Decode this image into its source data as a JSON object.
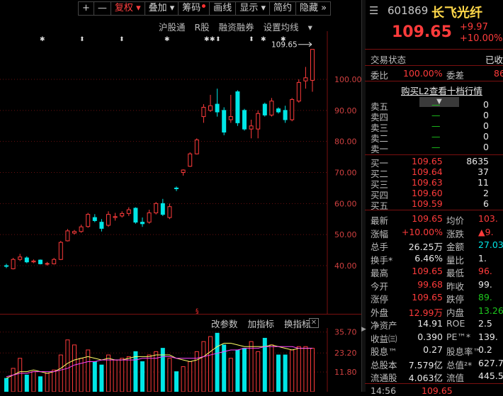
{
  "toolbar": {
    "plus": "+",
    "minus": "—",
    "fuquan": "复权",
    "diejia": "叠加",
    "chouma": "筹码",
    "huaxian": "画线",
    "xianshi": "显示",
    "jianyue": "简约",
    "yincang": "隐藏",
    "expand": "»"
  },
  "chart_links": [
    "沪股通",
    "R股",
    "融资融券",
    "设置均线"
  ],
  "price_axis": [
    "100.00",
    "90.00",
    "80.00",
    "70.00",
    "60.00",
    "50.00",
    "40.00"
  ],
  "high_label": "109.65",
  "volume_axis": [
    "35.70",
    "23.20",
    "11.80"
  ],
  "indicator_tools": [
    "改参数",
    "加指标",
    "换指标"
  ],
  "colors": {
    "up": "#ff3b3b",
    "down": "#00e6e6",
    "bg": "#000000",
    "grid": "#7a1010"
  },
  "stock": {
    "code": "601869",
    "name": "长飞光纤",
    "price": "109.65",
    "change": "+9.97",
    "change_pct": "+10.00%"
  },
  "status": {
    "label": "交易状态",
    "value": "已收"
  },
  "weibi": {
    "label": "委比",
    "value": "100.00%",
    "label2": "委差",
    "value2": "86"
  },
  "l2_button": "购买L2查看十档行情",
  "order_book": {
    "asks": [
      {
        "label": "卖五",
        "price": "—",
        "vol": "0"
      },
      {
        "label": "卖四",
        "price": "—",
        "vol": "0"
      },
      {
        "label": "卖三",
        "price": "—",
        "vol": "0"
      },
      {
        "label": "卖二",
        "price": "—",
        "vol": "0"
      },
      {
        "label": "卖一",
        "price": "—",
        "vol": "0"
      }
    ],
    "bids": [
      {
        "label": "买一",
        "price": "109.65",
        "vol": "8635"
      },
      {
        "label": "买二",
        "price": "109.64",
        "vol": "37"
      },
      {
        "label": "买三",
        "price": "109.63",
        "vol": "11"
      },
      {
        "label": "买四",
        "price": "109.60",
        "vol": "2"
      },
      {
        "label": "买五",
        "price": "109.59",
        "vol": "6"
      }
    ]
  },
  "quote": [
    {
      "l1": "最新",
      "v1": "109.65",
      "c1": "red",
      "l2": "均价",
      "v2": "103.",
      "c2": "red"
    },
    {
      "l1": "涨幅",
      "v1": "+10.00%",
      "c1": "red",
      "l2": "涨跌",
      "v2": "▲9.",
      "c2": "red"
    },
    {
      "l1": "总手",
      "v1": "26.25万",
      "c1": "white",
      "l2": "金额",
      "v2": "27.03",
      "c2": "cyan"
    },
    {
      "l1": "换手*",
      "v1": "6.46%",
      "c1": "white",
      "l2": "量比",
      "v2": "1.",
      "c2": "white"
    },
    {
      "l1": "最高",
      "v1": "109.65",
      "c1": "red",
      "l2": "最低",
      "v2": "96.",
      "c2": "red"
    },
    {
      "l1": "今开",
      "v1": "99.68",
      "c1": "red",
      "l2": "昨收",
      "v2": "99.",
      "c2": "white"
    },
    {
      "l1": "涨停",
      "v1": "109.65",
      "c1": "red",
      "l2": "跌停",
      "v2": "89.",
      "c2": "green"
    },
    {
      "l1": "外盘",
      "v1": "12.99万",
      "c1": "red",
      "l2": "内盘",
      "v2": "13.26",
      "c2": "green"
    },
    {
      "l1": "净资产",
      "v1": "14.91",
      "c1": "white",
      "l2": "ROE",
      "v2": "2.5",
      "c2": "white"
    },
    {
      "l1": "收益㈢",
      "v1": "0.390",
      "c1": "white",
      "l2": "PE™*",
      "v2": "139.",
      "c2": "white"
    },
    {
      "l1": "股息™",
      "v1": "0.27",
      "c1": "white",
      "l2": "股息率™",
      "v2": "0.2",
      "c2": "white"
    },
    {
      "l1": "总股本",
      "v1": "7.579亿",
      "c1": "white",
      "l2": "总值²*",
      "v2": "627.7",
      "c2": "white"
    },
    {
      "l1": "流通股",
      "v1": "4.063亿",
      "c1": "white",
      "l2": "流值",
      "v2": "445.5",
      "c2": "white"
    }
  ],
  "last_trade": {
    "time": "14:56",
    "price": "109.65"
  },
  "chart_data": {
    "type": "candlestick",
    "ylim": [
      36,
      112
    ],
    "candles": [
      {
        "o": 40.0,
        "h": 40.6,
        "l": 39.2,
        "c": 39.8
      },
      {
        "o": 39.0,
        "h": 42.5,
        "l": 38.8,
        "c": 42.0
      },
      {
        "o": 42.0,
        "h": 43.8,
        "l": 41.5,
        "c": 42.8
      },
      {
        "o": 42.5,
        "h": 43.0,
        "l": 40.8,
        "c": 41.2
      },
      {
        "o": 41.2,
        "h": 42.0,
        "l": 40.8,
        "c": 41.5
      },
      {
        "o": 41.8,
        "h": 42.0,
        "l": 40.4,
        "c": 40.6
      },
      {
        "o": 40.6,
        "h": 41.2,
        "l": 40.0,
        "c": 40.7
      },
      {
        "o": 40.6,
        "h": 42.5,
        "l": 40.4,
        "c": 42.0
      },
      {
        "o": 42.0,
        "h": 48.0,
        "l": 41.8,
        "c": 47.5
      },
      {
        "o": 48.0,
        "h": 51.8,
        "l": 47.8,
        "c": 51.2
      },
      {
        "o": 50.5,
        "h": 51.5,
        "l": 50.0,
        "c": 51.0
      },
      {
        "o": 51.0,
        "h": 53.2,
        "l": 50.6,
        "c": 52.5
      },
      {
        "o": 52.6,
        "h": 57.0,
        "l": 52.2,
        "c": 56.5
      },
      {
        "o": 55.5,
        "h": 56.6,
        "l": 54.0,
        "c": 54.5
      },
      {
        "o": 54.0,
        "h": 55.0,
        "l": 51.0,
        "c": 52.0
      },
      {
        "o": 53.0,
        "h": 57.5,
        "l": 52.5,
        "c": 56.5
      },
      {
        "o": 55.5,
        "h": 57.0,
        "l": 54.5,
        "c": 55.8
      },
      {
        "o": 56.0,
        "h": 57.5,
        "l": 55.5,
        "c": 56.8
      },
      {
        "o": 56.8,
        "h": 58.8,
        "l": 56.0,
        "c": 58.0
      },
      {
        "o": 58.5,
        "h": 58.8,
        "l": 53.5,
        "c": 54.0
      },
      {
        "o": 54.0,
        "h": 55.5,
        "l": 52.5,
        "c": 53.5
      },
      {
        "o": 54.0,
        "h": 58.0,
        "l": 53.5,
        "c": 57.0
      },
      {
        "o": 57.0,
        "h": 60.5,
        "l": 56.5,
        "c": 60.0
      },
      {
        "o": 60.0,
        "h": 61.5,
        "l": 56.0,
        "c": 56.5
      },
      {
        "o": 55.5,
        "h": 60.0,
        "l": 55.0,
        "c": 59.0
      },
      {
        "o": 65.0,
        "h": 65.5,
        "l": 64.0,
        "c": 64.8
      },
      {
        "o": 70.0,
        "h": 71.0,
        "l": 69.0,
        "c": 70.8
      },
      {
        "o": 72.0,
        "h": 76.5,
        "l": 71.8,
        "c": 76.0
      },
      {
        "o": 76.0,
        "h": 81.0,
        "l": 75.8,
        "c": 80.5
      },
      {
        "o": 88.0,
        "h": 92.0,
        "l": 86.0,
        "c": 91.0
      },
      {
        "o": 90.0,
        "h": 95.0,
        "l": 89.5,
        "c": 91.5
      },
      {
        "o": 92.0,
        "h": 97.0,
        "l": 88.0,
        "c": 89.5
      },
      {
        "o": 90.0,
        "h": 91.0,
        "l": 82.0,
        "c": 83.0
      },
      {
        "o": 87.0,
        "h": 95.0,
        "l": 86.0,
        "c": 88.0
      },
      {
        "o": 96.0,
        "h": 96.5,
        "l": 85.0,
        "c": 86.0
      },
      {
        "o": 90.0,
        "h": 90.5,
        "l": 83.5,
        "c": 84.0
      },
      {
        "o": 84.0,
        "h": 87.0,
        "l": 81.0,
        "c": 85.0
      },
      {
        "o": 84.0,
        "h": 90.0,
        "l": 81.0,
        "c": 89.0
      },
      {
        "o": 92.0,
        "h": 92.5,
        "l": 88.0,
        "c": 88.5
      },
      {
        "o": 88.5,
        "h": 94.0,
        "l": 88.0,
        "c": 93.0
      },
      {
        "o": 90.5,
        "h": 91.0,
        "l": 89.0,
        "c": 89.5
      },
      {
        "o": 90.0,
        "h": 91.5,
        "l": 86.0,
        "c": 87.0
      },
      {
        "o": 87.0,
        "h": 94.0,
        "l": 86.5,
        "c": 93.5
      },
      {
        "o": 93.0,
        "h": 100.0,
        "l": 92.5,
        "c": 99.0
      },
      {
        "o": 99.5,
        "h": 104.0,
        "l": 97.0,
        "c": 100.5
      },
      {
        "o": 99.68,
        "h": 109.65,
        "l": 96.0,
        "c": 109.65
      }
    ],
    "volume": [
      8,
      14,
      20,
      10,
      12,
      9,
      11,
      13,
      22,
      31,
      28,
      20,
      25,
      18,
      16,
      22,
      19,
      20,
      21,
      24,
      18,
      22,
      24,
      26,
      20,
      12,
      15,
      18,
      24,
      30,
      33,
      35,
      28,
      20,
      25,
      26,
      30,
      24,
      32,
      28,
      22,
      22,
      25,
      27,
      27,
      26
    ],
    "ma_volume_a": [
      8,
      10,
      12,
      12,
      13,
      12,
      11,
      12,
      14,
      17,
      19,
      20,
      21,
      20,
      19,
      20,
      19,
      19,
      20,
      21,
      21,
      21,
      22,
      22,
      22,
      20,
      19,
      18,
      19,
      21,
      24,
      27,
      29,
      29,
      28,
      27,
      27,
      27,
      27,
      28,
      27,
      26,
      25,
      26,
      26,
      26
    ],
    "ma_volume_b": [
      9,
      10,
      11,
      11,
      12,
      12,
      12,
      12,
      13,
      14,
      16,
      17,
      18,
      18,
      19,
      19,
      19,
      19,
      19,
      19,
      20,
      20,
      20,
      21,
      21,
      20,
      20,
      20,
      20,
      21,
      22,
      23,
      24,
      25,
      25,
      26,
      26,
      26,
      27,
      27,
      27,
      27,
      27,
      26,
      26,
      26
    ]
  }
}
